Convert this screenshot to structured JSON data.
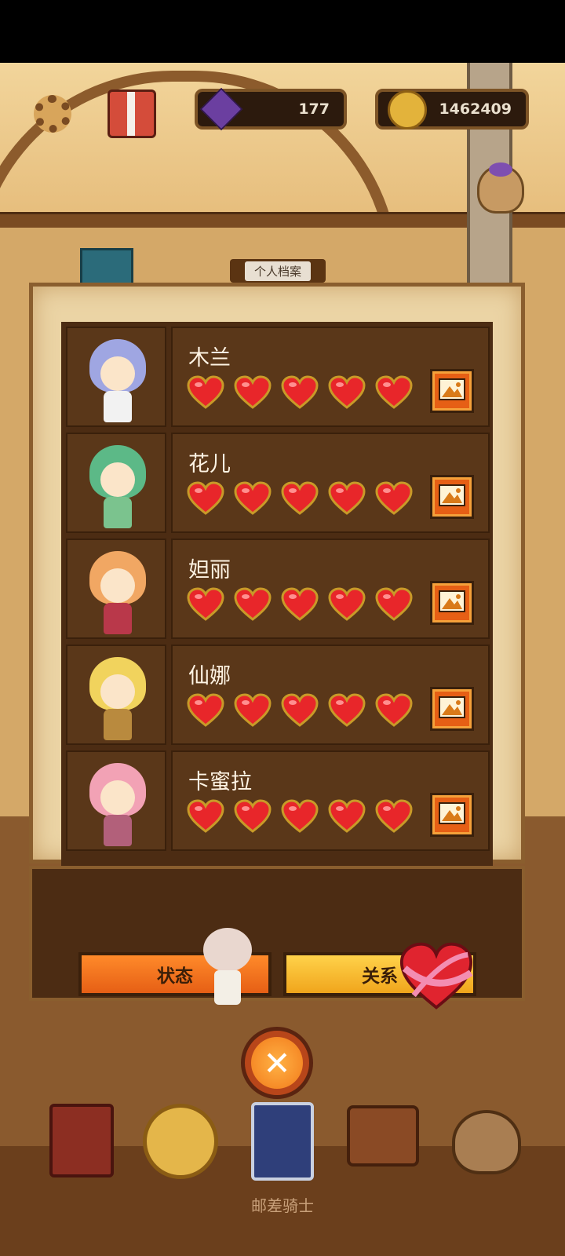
{
  "header": {
    "gems": "177",
    "coins": "1462409",
    "icons": [
      "gear-icon",
      "gift-icon",
      "gem-icon",
      "coin-icon",
      "gem-sack-icon"
    ]
  },
  "panel": {
    "title": "个人档案",
    "characters": [
      {
        "name": "木兰",
        "hearts": 5
      },
      {
        "name": "花儿",
        "hearts": 5
      },
      {
        "name": "妲丽",
        "hearts": 5
      },
      {
        "name": "仙娜",
        "hearts": 5
      },
      {
        "name": "卡蜜拉",
        "hearts": 5
      }
    ]
  },
  "tabs": {
    "status": "状态",
    "relation": "关系"
  },
  "close_icon": "close-icon",
  "nav": [
    "book-icon",
    "medal-icon",
    "cards-icon",
    "satchel-icon",
    "treasure-sack-icon"
  ],
  "footer": {
    "app_name": "邮差骑士"
  },
  "colors": {
    "heart": "#e8262a",
    "accent_orange": "#e65f15",
    "accent_yellow": "#f0a51c",
    "panel_bg": "#ebd4a5",
    "list_bg": "#4c2c13"
  }
}
